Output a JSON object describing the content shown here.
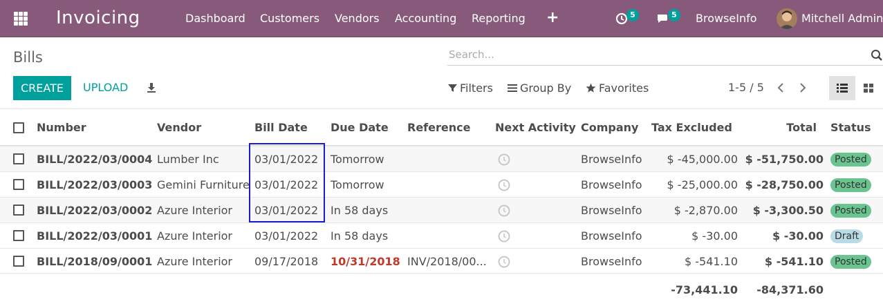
{
  "navbar": {
    "app_name": "Invoicing",
    "menu": [
      "Dashboard",
      "Customers",
      "Vendors",
      "Accounting",
      "Reporting"
    ],
    "plus_label": "+",
    "activity_count": "5",
    "messages_count": "5",
    "company": "BrowseInfo",
    "user": "Mitchell Admin"
  },
  "control_panel": {
    "breadcrumb": "Bills",
    "search_placeholder": "Search...",
    "create_label": "CREATE",
    "upload_label": "UPLOAD",
    "filters_label": "Filters",
    "group_by_label": "Group By",
    "favorites_label": "Favorites",
    "pager": "1-5 / 5"
  },
  "table": {
    "headers": {
      "number": "Number",
      "vendor": "Vendor",
      "bill_date": "Bill Date",
      "due_date": "Due Date",
      "reference": "Reference",
      "next_activity": "Next Activity",
      "company": "Company",
      "tax_excluded": "Tax Excluded",
      "total": "Total",
      "status": "Status"
    },
    "rows": [
      {
        "number": "BILL/2022/03/0004",
        "vendor": "Lumber Inc",
        "bill_date": "03/01/2022",
        "due_date": "Tomorrow",
        "reference": "",
        "company": "BrowseInfo",
        "tax_excluded": "$ -45,000.00",
        "total": "$ -51,750.00",
        "status": "Posted"
      },
      {
        "number": "BILL/2022/03/0003",
        "vendor": "Gemini Furniture",
        "bill_date": "03/01/2022",
        "due_date": "Tomorrow",
        "reference": "",
        "company": "BrowseInfo",
        "tax_excluded": "$ -25,000.00",
        "total": "$ -28,750.00",
        "status": "Posted"
      },
      {
        "number": "BILL/2022/03/0002",
        "vendor": "Azure Interior",
        "bill_date": "03/01/2022",
        "due_date": "In 58 days",
        "reference": "",
        "company": "BrowseInfo",
        "tax_excluded": "$ -2,870.00",
        "total": "$ -3,300.50",
        "status": "Posted"
      },
      {
        "number": "BILL/2022/03/0001",
        "vendor": "Azure Interior",
        "bill_date": "03/01/2022",
        "due_date": "In 58 days",
        "reference": "",
        "company": "BrowseInfo",
        "tax_excluded": "$ -30.00",
        "total": "$ -30.00",
        "status": "Draft"
      },
      {
        "number": "BILL/2018/09/0001",
        "vendor": "Azure Interior",
        "bill_date": "09/17/2018",
        "due_date": "10/31/2018",
        "reference": "INV/2018/00...",
        "company": "BrowseInfo",
        "tax_excluded": "$ -541.10",
        "total": "$ -541.10",
        "status": "Posted"
      }
    ],
    "totals": {
      "tax_excluded": "-73,441.10",
      "total": "-84,371.60"
    }
  },
  "colors": {
    "navbar": "#875a7b",
    "primary": "#00a09d",
    "posted": "#6ac48f",
    "draft": "#b9dbe6",
    "overdue": "#c0392b",
    "highlight": "#1a1ad0"
  },
  "icons": [
    "apps-grid-icon",
    "activity-clock-icon",
    "chat-icon",
    "search-icon",
    "download-icon",
    "filter-icon",
    "group-by-icon",
    "star-icon",
    "chevron-left-icon",
    "chevron-right-icon",
    "list-view-icon",
    "kanban-view-icon",
    "clock-icon"
  ]
}
